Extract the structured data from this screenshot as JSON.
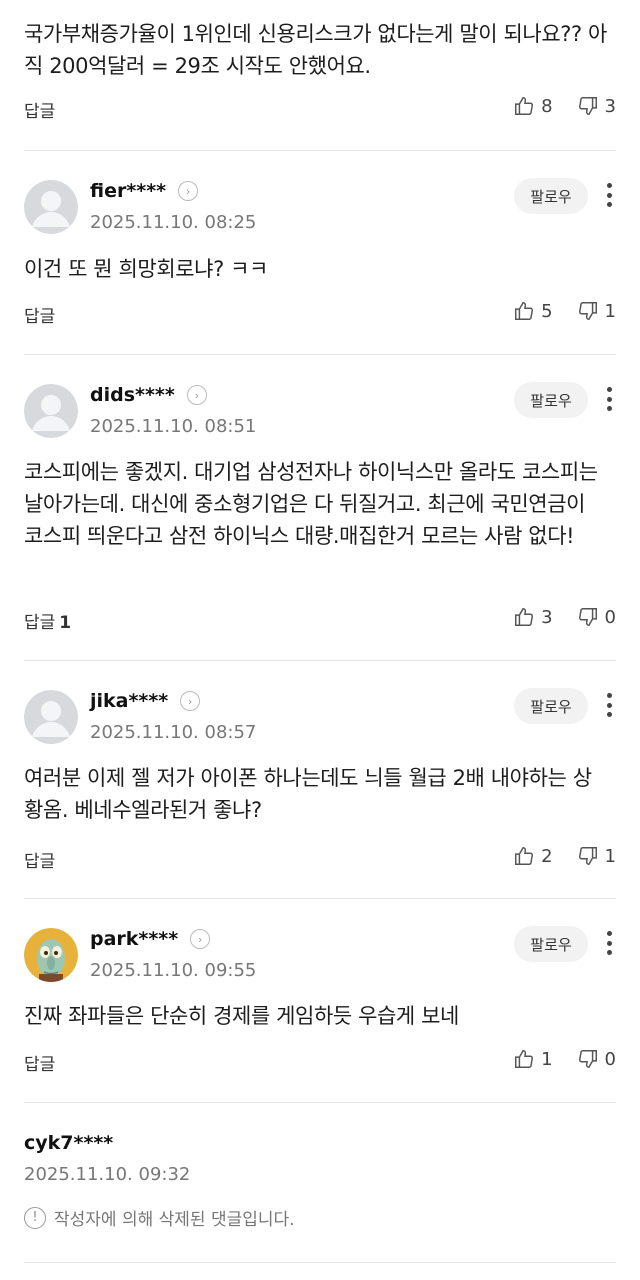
{
  "labels": {
    "reply": "답글",
    "follow": "팔로우"
  },
  "top_comment": {
    "text": "국가부채증가율이 1위인데 신용리스크가 없다는게 말이 되나요?? 아직 200억달러 = 29조 시작도 안했어요.",
    "likes": "8",
    "dislikes": "3"
  },
  "comments": [
    {
      "nick": "fier****",
      "date": "2025.11.10. 08:25",
      "text": "이건 또 뭔 희망회로냐? ㅋㅋ",
      "reply_count": "",
      "likes": "5",
      "dislikes": "1",
      "avatar": "default"
    },
    {
      "nick": "dids****",
      "date": "2025.11.10. 08:51",
      "text": "코스피에는 좋겠지. 대기업 삼성전자나 하이닉스만 올라도 코스피는 날아가는데. 대신에 중소형기업은 다 뒤질거고. 최근에 국민연금이 코스피 띄운다고 삼전 하이닉스 대량.매집한거 모르는 사람 없다!",
      "reply_count": "1",
      "likes": "3",
      "dislikes": "0",
      "avatar": "default"
    },
    {
      "nick": "jika****",
      "date": "2025.11.10. 08:57",
      "text": "여러분 이제 젤 저가 아이폰 하나는데도 늬들 월급 2배 내야하는 상황옴. 베네수엘라된거 좋냐?",
      "reply_count": "",
      "likes": "2",
      "dislikes": "1",
      "avatar": "default"
    },
    {
      "nick": "park****",
      "date": "2025.11.10. 09:55",
      "text": "진짜 좌파들은 단순히 경제를 게임하듯 우습게 보네",
      "reply_count": "",
      "likes": "1",
      "dislikes": "0",
      "avatar": "character"
    }
  ],
  "deleted": {
    "nick": "cyk7****",
    "date": "2025.11.10. 09:32",
    "message": "작성자에 의해 삭제된 댓글입니다."
  },
  "icons": {
    "like": "thumbs-up-icon",
    "dislike": "thumbs-down-icon",
    "more": "more-vertical-icon",
    "arrow": "chevron-right-icon",
    "info": "exclamation-circle-icon"
  }
}
